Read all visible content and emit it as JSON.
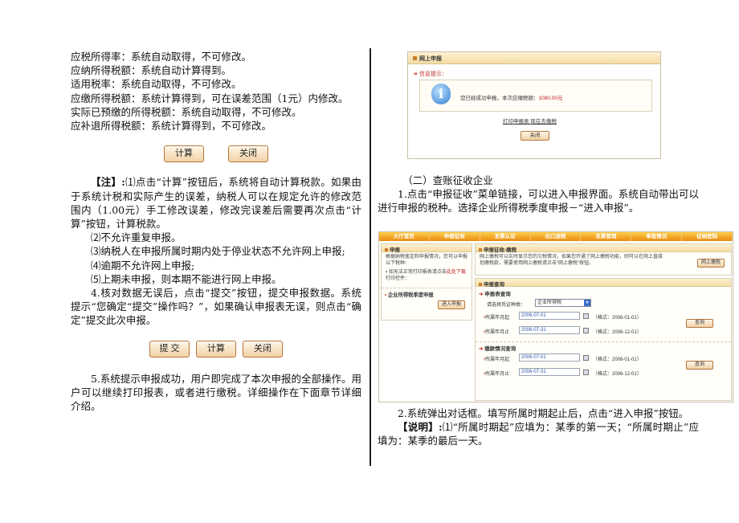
{
  "left": {
    "lines_top": [
      "应税所得率：系统自动取得，不可修改。",
      "应纳所得税额：系统自动计算得到。",
      "适用税率：系统自动取得，不可修改。",
      "应缴所得税额：系统计算得到，可在误差范围（1元）内修改。",
      "实际已预缴的所得税额：系统自动取得，不可修改。",
      "应补退所得税额：系统计算得到，不可修改。"
    ],
    "btn_calc": "计算",
    "btn_close": "关闭",
    "note_label": "【注】:",
    "note_p1": "⑴点击“计算”按钮后，系统将自动计算税款。如果由于系统计税和实际产生的误差，纳税人可以在规定允许的修改范围内（1.00元）手工修改误差，修改完误差后需要再次点击“计算”按钮，计算税款。",
    "note_items": [
      "⑵不允许重复申报。",
      "⑶纳税人在申报所属时期内处于停业状态不允许网上申报;",
      "⑷逾期不允许网上申报;",
      "⑸上期未申报，则本期不能进行网上申报。"
    ],
    "step4": "4.核对数据无误后，点击“提交”按钮，提交申报数据。系统提示“您确定“提交”操作吗？”，如果确认申报表无误，则点击“确定”提交此次申报。",
    "btn_submit": "提 交",
    "btn_calc2": "计算",
    "btn_close2": "关闭",
    "step5": "5.系统提示申报成功，用户即完成了本次申报的全部操作。用户可以继续打印报表，或者进行缴税。详细操作在下面章节详细介绍。"
  },
  "right": {
    "section_title": "（二）查账征收企业",
    "step1": "1.点击“申报征收”菜单链接，可以进入申报界面。系统自动带出可以进行申报的税种。选择企业所得税季度申报－“进入申报”。",
    "step2": "2.系统弹出对话框。填写所属时期起止后，点击“进入申报”按钮。",
    "note_label": "【说明】:",
    "note_text": "⑴“所属时期起”应填为：某季的第一天；“所属时期止”应填为：某季的最后一天。"
  },
  "shot1": {
    "header": "网上申报",
    "tip": "信息提示：",
    "message": "您已经成功申报，本次应缴税额：",
    "amount": "1080.00元",
    "link_print": "打印申报表",
    "link_pay": "现在去缴税",
    "btn_close": "关闭"
  },
  "shot2": {
    "nav": [
      "大厅首页",
      "申报征收",
      "发票认证",
      "出口退税",
      "发票管理",
      "审批情况",
      "征纳登陆"
    ],
    "left_title": "申报",
    "left_text1": "根据纳税鉴定和申报情况，您可以申报以下税种：",
    "left_text2": "如无法正常打印报表请点击",
    "left_text2_red": "此处下载",
    "left_text3": "打印控件：",
    "left_sub": "企业所得税季度申报",
    "btn_enter": "进入申报",
    "right_title": "申报征收-缴税",
    "right_text": "网上缴税可以实时显示您的欠税情况，如果您开通了网上缴税功能，则可以在网上直接划缴税款，需要使用网上缴税请点击“网上缴税”按钮。",
    "btn_online_pay": "网上缴税",
    "query_title": "申报查询",
    "sec1": "申报表查询",
    "select_label": "请选择凭证种类：",
    "select_value": "企业所得税",
    "from_label": "所属年月起",
    "to_label": "所属年月止",
    "from_value": "2006-07-01",
    "to_value": "2006-07-31",
    "fmt_from": "（格式：2006-01-01）",
    "fmt_to": "（格式：2006-12-01）",
    "btn_query": "查询",
    "sec2": "缴款情况查询",
    "from_value2": "2006-07-01",
    "to_value2": "2006-07-31",
    "btn_query2": "查询"
  }
}
